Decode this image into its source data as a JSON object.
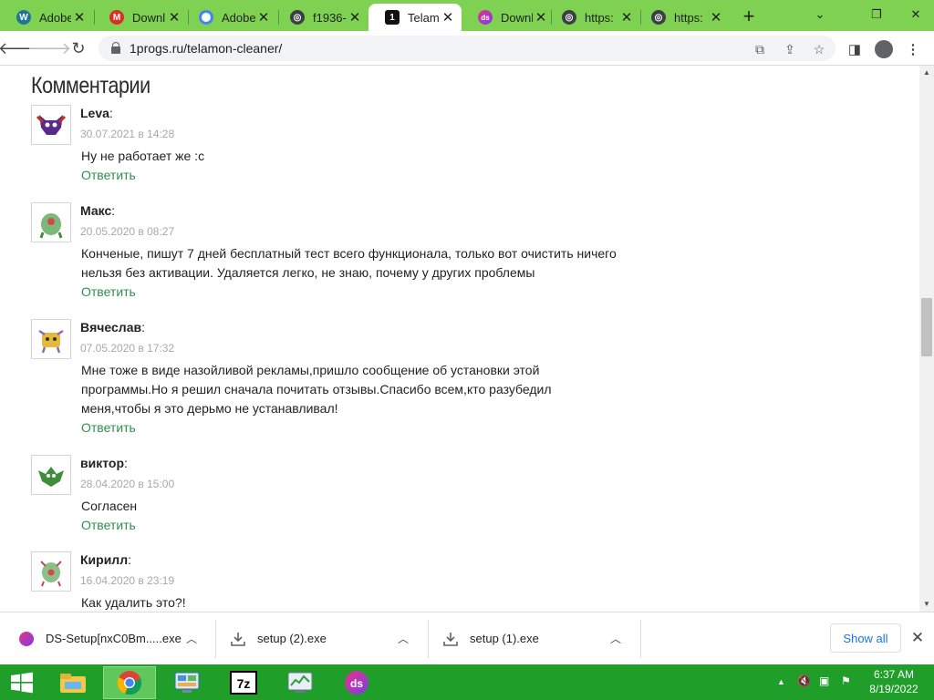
{
  "browser": {
    "tabs": [
      {
        "title": "Adobe",
        "icon": "wordpress-icon"
      },
      {
        "title": "Downl",
        "icon": "gmail-icon"
      },
      {
        "title": "Adobe",
        "icon": "google-icon"
      },
      {
        "title": "f1936-",
        "icon": "globe-icon"
      },
      {
        "title": "Telam",
        "icon": "site-1-icon",
        "active": true
      },
      {
        "title": "Downl",
        "icon": "ds-icon"
      },
      {
        "title": "https:",
        "icon": "globe-icon"
      },
      {
        "title": "https:",
        "icon": "globe-icon"
      }
    ],
    "url": "1progs.ru/telamon-cleaner/"
  },
  "page": {
    "section_title": "Комментарии",
    "reply_label": "Ответить",
    "comments": [
      {
        "author": "Leva",
        "date": "30.07.2021 в 14:28",
        "text": "Ну не работает же :c"
      },
      {
        "author": "Макс",
        "date": "20.05.2020 в 08:27",
        "text": "Конченые, пишут 7 дней бесплатный тест всего функционала, только вот очистить ничего нельзя без активации. Удаляется легко, не знаю, почему у других проблемы"
      },
      {
        "author": "Вячеслав",
        "date": "07.05.2020 в 17:32",
        "text": "Мне тоже в виде назойливой рекламы,пришло сообщение об установки этой программы.Но я решил сначала почитать отзывы.Спасибо всем,кто разубедил меня,чтобы я это дерьмо не устанавливал!"
      },
      {
        "author": "виктор",
        "date": "28.04.2020 в 15:00",
        "text": "Согласен"
      },
      {
        "author": "Кирилл",
        "date": "16.04.2020 в 23:19",
        "text": "Как удалить это?!"
      }
    ]
  },
  "downloads": {
    "items": [
      {
        "name": "DS-Setup[nxC0Bm.....exe",
        "icon": "ds-file-icon"
      },
      {
        "name": "setup (2).exe",
        "icon": "download-file-icon"
      },
      {
        "name": "setup (1).exe",
        "icon": "download-file-icon"
      }
    ],
    "show_all": "Show all"
  },
  "taskbar": {
    "time": "6:37 AM",
    "date": "8/19/2022",
    "apps": [
      "file-explorer-icon",
      "chrome-icon",
      "control-panel-icon",
      "7zip-icon",
      "task-manager-icon",
      "ds-app-icon"
    ]
  },
  "colors": {
    "tabstrip": "#7fd152",
    "taskbar": "#1f9e2a",
    "reply_link": "#2f8f4f",
    "date_text": "#a8a8a8"
  }
}
